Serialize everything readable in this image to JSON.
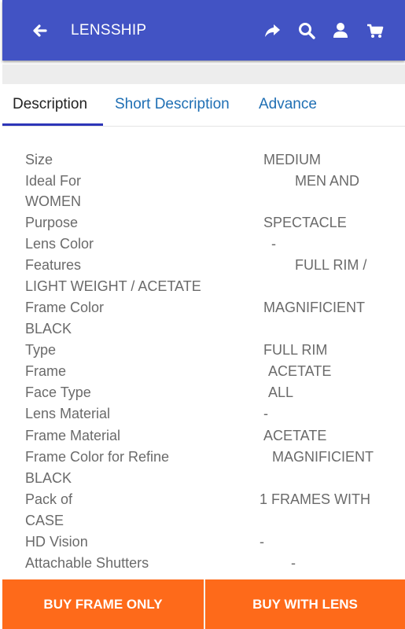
{
  "appbar": {
    "title": "LENSSHIP",
    "icons": [
      "back-arrow-icon",
      "share-icon",
      "search-icon",
      "user-icon",
      "cart-icon"
    ]
  },
  "tabs": [
    {
      "label": "Description",
      "active": true
    },
    {
      "label": "Short Description",
      "active": false
    },
    {
      "label": "Advance",
      "active": false
    }
  ],
  "specs": [
    {
      "label": "Size",
      "value": "MEDIUM"
    },
    {
      "label": "Ideal For",
      "value": "MEN AND",
      "value_cont": "WOMEN"
    },
    {
      "label": "Purpose",
      "value": "SPECTACLE"
    },
    {
      "label": "Lens Color",
      "value": "-"
    },
    {
      "label": "Features",
      "value": "FULL RIM /",
      "value_cont": "LIGHT WEIGHT / ACETATE"
    },
    {
      "label": "Frame Color",
      "value": "MAGNIFICIENT",
      "value_cont": "BLACK"
    },
    {
      "label": "Type",
      "value": "FULL RIM"
    },
    {
      "label": "Frame",
      "value": "ACETATE"
    },
    {
      "label": "Face Type",
      "value": "ALL"
    },
    {
      "label": "Lens Material",
      "value": "-"
    },
    {
      "label": "Frame Material",
      "value": "ACETATE"
    },
    {
      "label": "Frame Color for Refine",
      "value": "MAGNIFICIENT",
      "value_cont": "BLACK"
    },
    {
      "label": "Pack of",
      "value": "1 FRAMES WITH",
      "value_cont": "CASE"
    },
    {
      "label": "HD Vision",
      "value": "-"
    },
    {
      "label": "Attachable Shutters",
      "value": "-"
    }
  ],
  "actions": {
    "buy_frame_label": "BUY FRAME ONLY",
    "buy_lens_label": "BUY WITH LENS"
  },
  "colors": {
    "appbar": "#4253c4",
    "tab_link": "#1f6fb4",
    "tab_indicator": "#2d35b8",
    "bottom_bar": "#fe6a1a"
  }
}
